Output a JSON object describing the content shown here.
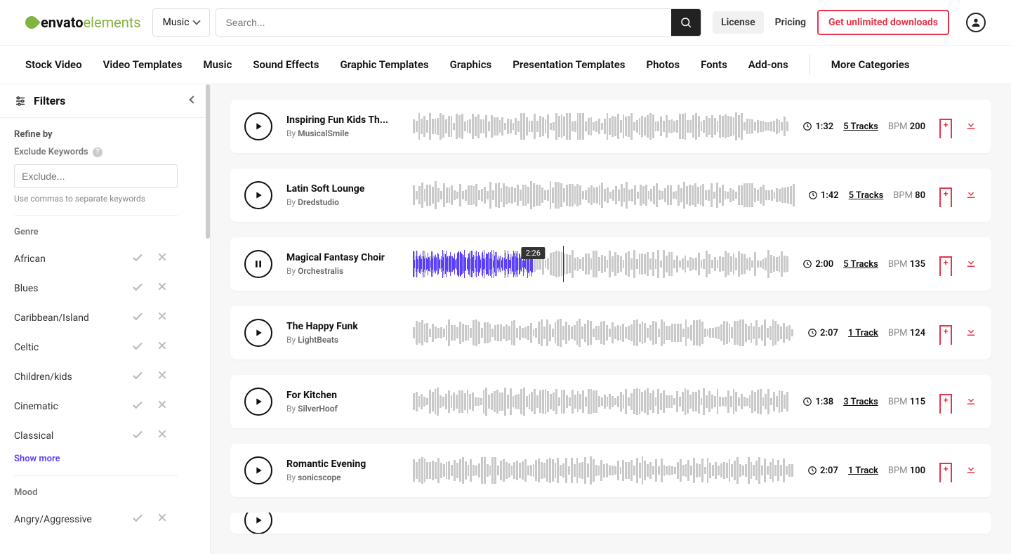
{
  "header": {
    "logo_a": "envato",
    "logo_b": "elements",
    "category": "Music",
    "search_placeholder": "Search...",
    "license": "License",
    "pricing": "Pricing",
    "cta": "Get unlimited downloads"
  },
  "nav": {
    "items": [
      "Stock Video",
      "Video Templates",
      "Music",
      "Sound Effects",
      "Graphic Templates",
      "Graphics",
      "Presentation Templates",
      "Photos",
      "Fonts",
      "Add-ons"
    ],
    "more": "More Categories"
  },
  "sidebar": {
    "filters": "Filters",
    "refine": "Refine by",
    "exclude_label": "Exclude Keywords",
    "exclude_placeholder": "Exclude...",
    "exclude_hint": "Use commas to separate keywords",
    "genre": "Genre",
    "genres": [
      "African",
      "Blues",
      "Caribbean/Island",
      "Celtic",
      "Children/kids",
      "Cinematic",
      "Classical"
    ],
    "show_more": "Show more",
    "mood": "Mood",
    "moods": [
      "Angry/Aggressive"
    ]
  },
  "labels": {
    "by": "By",
    "bpm": "BPM"
  },
  "tracks": [
    {
      "title": "Inspiring Fun Kids Th...",
      "author": "MusicalSmile",
      "duration": "1:32",
      "tracks": "5 Tracks",
      "bpm": "200",
      "playing": false,
      "progress": 0
    },
    {
      "title": "Latin Soft Lounge",
      "author": "Dredstudio",
      "duration": "1:42",
      "tracks": "5 Tracks",
      "bpm": "80",
      "playing": false,
      "progress": 3
    },
    {
      "title": "Magical Fantasy Choir",
      "author": "Orchestralis",
      "duration": "2:00",
      "tracks": "5 Tracks",
      "bpm": "135",
      "playing": true,
      "progress": 32,
      "tooltip": "2:26",
      "cursor": 40
    },
    {
      "title": "The Happy Funk",
      "author": "LightBeats",
      "duration": "2:07",
      "tracks": "1 Track",
      "bpm": "124",
      "playing": false,
      "progress": 0
    },
    {
      "title": "For Kitchen",
      "author": "SilverHoof",
      "duration": "1:38",
      "tracks": "3 Tracks",
      "bpm": "115",
      "playing": false,
      "progress": 0
    },
    {
      "title": "Romantic Evening",
      "author": "sonicscope",
      "duration": "2:07",
      "tracks": "1 Track",
      "bpm": "100",
      "playing": false,
      "progress": 0
    }
  ]
}
